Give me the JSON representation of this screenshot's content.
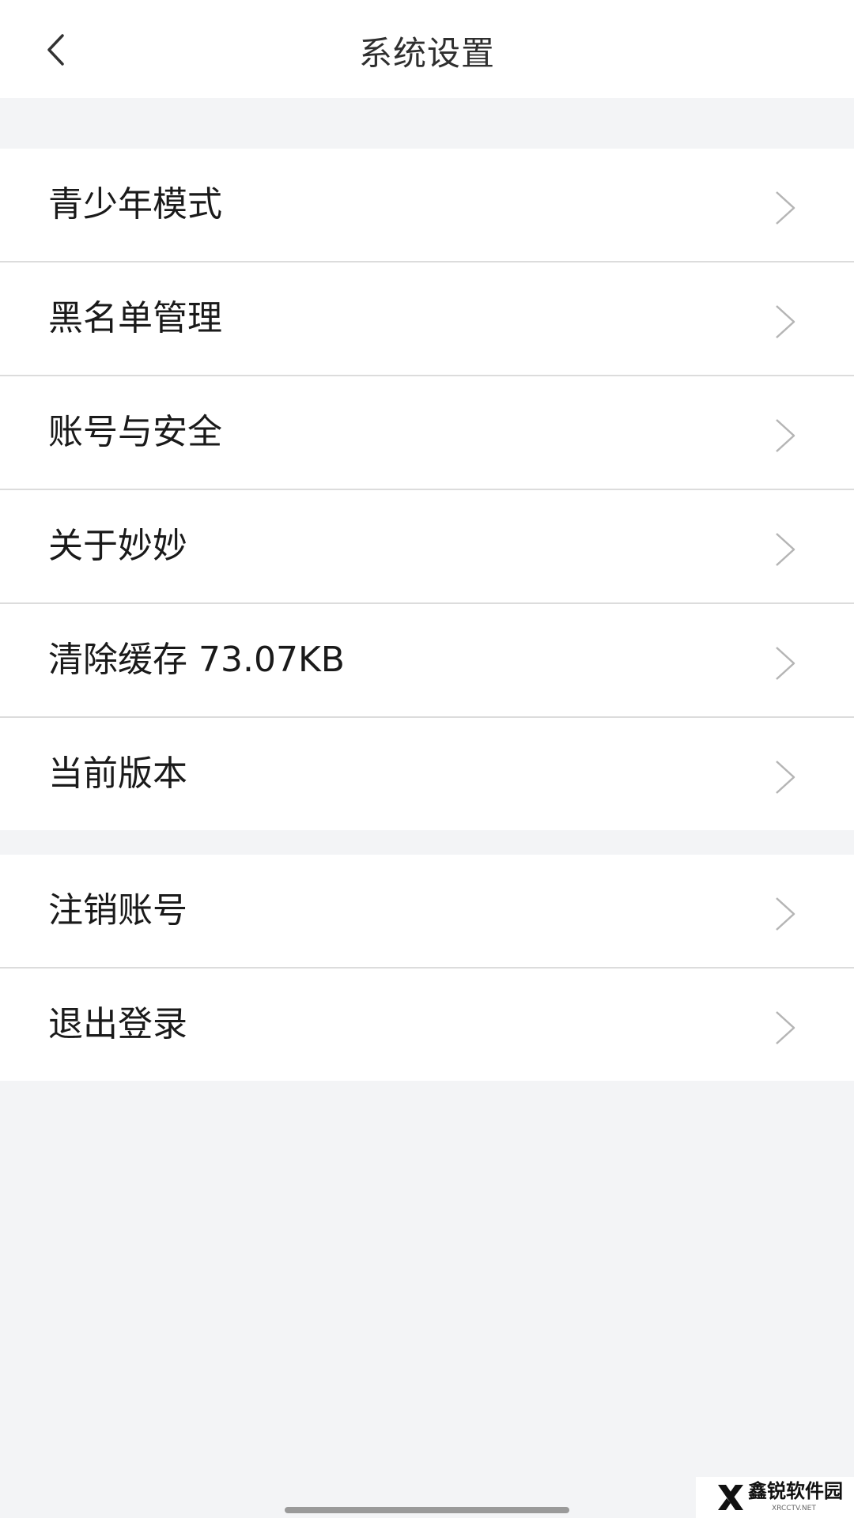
{
  "header": {
    "title": "系统设置",
    "back_icon": "back-arrow-icon"
  },
  "settings_group_1": [
    {
      "label": "青少年模式"
    },
    {
      "label": "黑名单管理"
    },
    {
      "label": "账号与安全"
    },
    {
      "label": "关于妙妙"
    },
    {
      "label": "清除缓存 73.07KB"
    },
    {
      "label": "当前版本"
    }
  ],
  "settings_group_2": [
    {
      "label": "注销账号"
    },
    {
      "label": "退出登录"
    }
  ],
  "watermark": {
    "name": "鑫锐软件园",
    "url": "XRCCTV.NET"
  },
  "colors": {
    "background": "#f3f4f6",
    "surface": "#ffffff",
    "divider": "#dcdcdc",
    "text": "#1a1a1a",
    "chevron": "#b5b5b5"
  }
}
